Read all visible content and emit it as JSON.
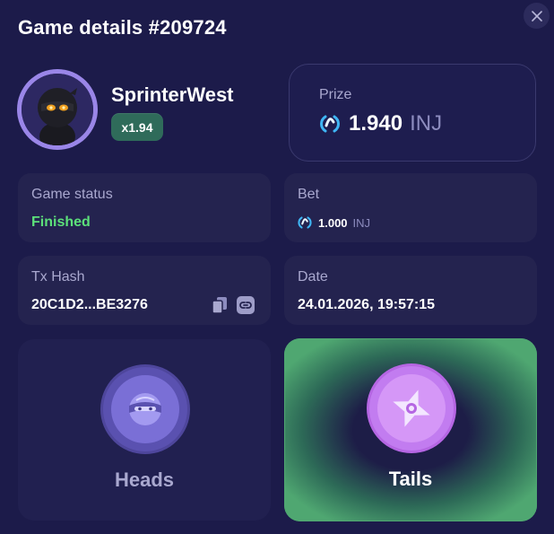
{
  "header": {
    "title": "Game details #209724"
  },
  "player": {
    "username": "SprinterWest",
    "multiplier": "x1.94"
  },
  "prize": {
    "label": "Prize",
    "amount": "1.940",
    "currency": "INJ"
  },
  "game_status": {
    "label": "Game status",
    "value": "Finished"
  },
  "bet": {
    "label": "Bet",
    "amount": "1.000",
    "currency": "INJ"
  },
  "tx_hash": {
    "label": "Tx Hash",
    "value": "20C1D2...BE3276"
  },
  "date": {
    "label": "Date",
    "value": "24.01.2026, 19:57:15"
  },
  "choices": {
    "heads_label": "Heads",
    "tails_label": "Tails",
    "selected": "Tails"
  },
  "colors": {
    "background": "#1c1b4a",
    "card": "#24234f",
    "status_finished": "#5ce07a",
    "tails_highlight": "#4fa771",
    "heads_coin": "#6c5fc4",
    "tails_coin": "#c97ef0"
  },
  "icons": {
    "close": "close-icon",
    "token": "injective-token-icon",
    "copy": "copy-icon",
    "link": "link-icon",
    "heads_coin": "ninja-face-icon",
    "tails_coin": "shuriken-icon"
  }
}
